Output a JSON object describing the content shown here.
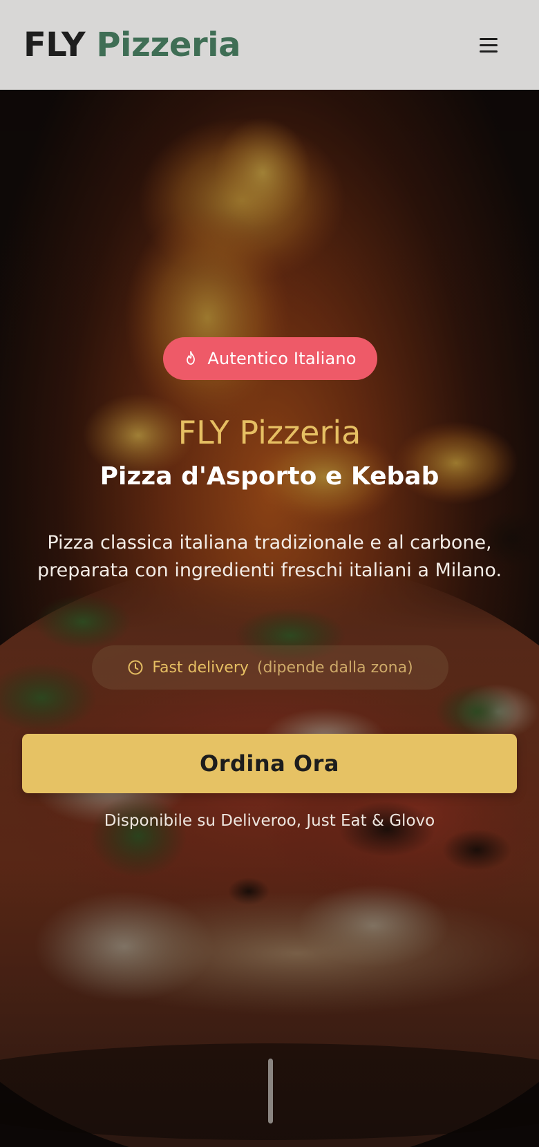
{
  "header": {
    "brand_part1": "FLY",
    "brand_part2": "Pizzeria",
    "menu_icon": "hamburger-menu-icon"
  },
  "hero": {
    "badge": {
      "icon": "flame-icon",
      "label": "Autentico Italiano"
    },
    "title": "FLY Pizzeria",
    "subtitle": "Pizza d'Asporto e Kebab",
    "description": "Pizza classica italiana tradizionale e al carbone, preparata con ingredienti freschi italiani a Milano.",
    "delivery": {
      "icon": "clock-icon",
      "label": "Fast delivery",
      "note": "(dipende dalla zona)"
    },
    "cta_label": "Ordina Ora",
    "availability": "Disponibile su Deliveroo, Just Eat & Glovo"
  },
  "colors": {
    "header_bg": "#d8d7d6",
    "brand_dark": "#1e1e1e",
    "brand_green": "#3f6e55",
    "badge_bg": "#ee5a68",
    "accent_gold": "#e6bf63",
    "cta_bg": "#e6c264"
  }
}
